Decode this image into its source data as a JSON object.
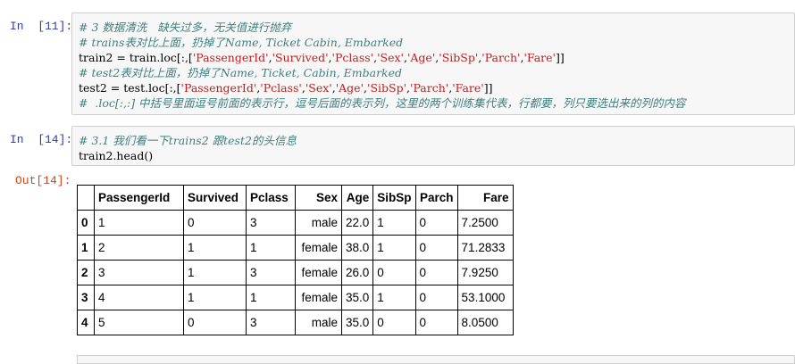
{
  "cells": [
    {
      "prompt": "In  [11]:",
      "lines": [
        [
          {
            "t": "# 3 数据清洗   缺失过多，无关值进行抛弃",
            "c": "cm"
          }
        ],
        [
          {
            "t": "# trains表对比上面，扔掉了Name, Ticket Cabin, Embarked",
            "c": "cm"
          }
        ],
        [
          {
            "t": "train2 = train.loc[:,[",
            "c": ""
          },
          {
            "t": "'PassengerId'",
            "c": "str"
          },
          {
            "t": ",",
            "c": ""
          },
          {
            "t": "'Survived'",
            "c": "str"
          },
          {
            "t": ",",
            "c": ""
          },
          {
            "t": "'Pclass'",
            "c": "str"
          },
          {
            "t": ",",
            "c": ""
          },
          {
            "t": "'Sex'",
            "c": "str"
          },
          {
            "t": ",",
            "c": ""
          },
          {
            "t": "'Age'",
            "c": "str"
          },
          {
            "t": ",",
            "c": ""
          },
          {
            "t": "'SibSp'",
            "c": "str"
          },
          {
            "t": ",",
            "c": ""
          },
          {
            "t": "'Parch'",
            "c": "str"
          },
          {
            "t": ",",
            "c": ""
          },
          {
            "t": "'Fare'",
            "c": "str"
          },
          {
            "t": "]]",
            "c": ""
          }
        ],
        [
          {
            "t": "# test2表对比上面，扔掉了Name, Ticket, Cabin, Embarked",
            "c": "cm"
          }
        ],
        [
          {
            "t": "test2 = test.loc[:,[",
            "c": ""
          },
          {
            "t": "'PassengerId'",
            "c": "str"
          },
          {
            "t": ",",
            "c": ""
          },
          {
            "t": "'Pclass'",
            "c": "str"
          },
          {
            "t": ",",
            "c": ""
          },
          {
            "t": "'Sex'",
            "c": "str"
          },
          {
            "t": ",",
            "c": ""
          },
          {
            "t": "'Age'",
            "c": "str"
          },
          {
            "t": ",",
            "c": ""
          },
          {
            "t": "'SibSp'",
            "c": "str"
          },
          {
            "t": ",",
            "c": ""
          },
          {
            "t": "'Parch'",
            "c": "str"
          },
          {
            "t": ",",
            "c": ""
          },
          {
            "t": "'Fare'",
            "c": "str"
          },
          {
            "t": "]]",
            "c": ""
          }
        ],
        [
          {
            "t": "#  .loc[:,:] 中括号里面逗号前面的表示行，逗号后面的表示列，这里的两个训练集代表，行都要，列只要选出来的列的内容",
            "c": "cm"
          }
        ]
      ]
    },
    {
      "prompt": "In  [14]:",
      "lines": [
        [
          {
            "t": "# 3.1 我们看一下trains2 跟test2的头信息",
            "c": "cm"
          }
        ],
        [
          {
            "t": "train2.head()",
            "c": ""
          }
        ]
      ]
    }
  ],
  "output": {
    "prompt": "Out[14]:",
    "columns": [
      "",
      "PassengerId",
      "Survived",
      "Pclass",
      "Sex",
      "Age",
      "SibSp",
      "Parch",
      "Fare"
    ],
    "rows": [
      [
        "0",
        "1",
        "0",
        "3",
        "male",
        "22.0",
        "1",
        "0",
        "7.2500"
      ],
      [
        "1",
        "2",
        "1",
        "1",
        "female",
        "38.0",
        "1",
        "0",
        "71.2833"
      ],
      [
        "2",
        "3",
        "1",
        "3",
        "female",
        "26.0",
        "0",
        "0",
        "7.9250"
      ],
      [
        "3",
        "4",
        "1",
        "1",
        "female",
        "35.0",
        "1",
        "0",
        "53.1000"
      ],
      [
        "4",
        "5",
        "0",
        "3",
        "male",
        "35.0",
        "0",
        "0",
        "8.0500"
      ]
    ]
  }
}
